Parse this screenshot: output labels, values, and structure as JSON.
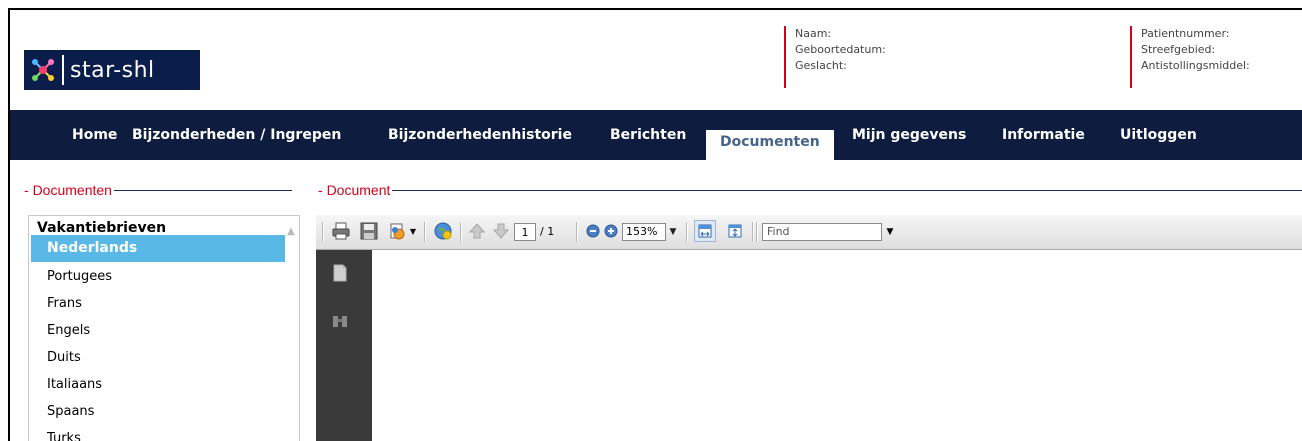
{
  "header": {
    "logo_text": "star-shl",
    "patient_fields_left": [
      "Naam:",
      "Geboortedatum:",
      "Geslacht:"
    ],
    "patient_fields_right": [
      "Patientnummer:",
      "Streefgebied:",
      "Antistollingsmiddel:"
    ]
  },
  "nav": {
    "items": [
      {
        "label": "Home"
      },
      {
        "label": "Bijzonderheden / Ingrepen"
      },
      {
        "label": "Bijzonderhedenhistorie"
      },
      {
        "label": "Berichten"
      },
      {
        "label": "Documenten",
        "active": true
      },
      {
        "label": "Mijn gegevens"
      },
      {
        "label": "Informatie"
      },
      {
        "label": "Uitloggen"
      }
    ]
  },
  "documents_panel": {
    "legend": "Documenten",
    "group_title": "Vakantiebrieven",
    "items": [
      "Nederlands",
      "Portugees",
      "Frans",
      "Engels",
      "Duits",
      "Italiaans",
      "Spaans",
      "Turks"
    ],
    "selected_index": 0
  },
  "document_panel": {
    "legend": "Document"
  },
  "pdf_viewer": {
    "page_current": "1",
    "page_total": "/ 1",
    "zoom": "153%",
    "find_placeholder": "Find"
  },
  "colors": {
    "nav_bg": "#0e1d3f",
    "accent_red": "#d0021b",
    "selected_bg": "#5ab8e6",
    "active_tab_text": "#46648a"
  }
}
